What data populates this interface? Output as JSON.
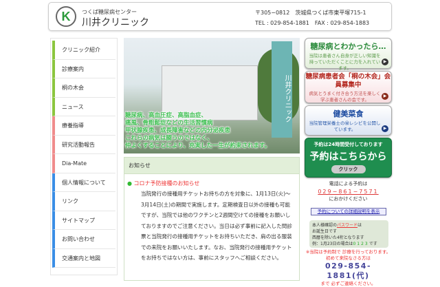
{
  "header": {
    "subtitle": "つくば糖尿病センター",
    "clinic_name": "川井クリニック",
    "logo_letter": "K",
    "address": "〒305−0812　茨城県つくば市東平塚715-1",
    "contact": "TEL : 029-854-1881　FAX : 029-854-1883"
  },
  "sidebar": {
    "items": [
      {
        "label": "クリニック紹介",
        "color": "#8cc63f"
      },
      {
        "label": "診療案内",
        "color": "#8cc63f"
      },
      {
        "label": "桐の木会",
        "color": "#8cc63f"
      },
      {
        "label": "ニュース",
        "color": "#8cc63f"
      },
      {
        "label": "療養指導",
        "color": "#f08c8c"
      },
      {
        "label": "研究活動報告",
        "color": "#f08c8c"
      },
      {
        "label": "Dia-Mate",
        "color": "#f08c8c"
      },
      {
        "label": "個人情報について",
        "color": "#3a8ee6"
      },
      {
        "label": "リンク",
        "color": "#3a8ee6"
      },
      {
        "label": "サイトマップ",
        "color": "#3a8ee6"
      },
      {
        "label": "お問い合わせ",
        "color": "#3a8ee6"
      },
      {
        "label": "交通案内と地図",
        "color": "#3a8ee6"
      }
    ]
  },
  "hero": {
    "sign": "川井クリニック",
    "lines": [
      "糖尿病、高血圧症、高脂血症、",
      "痛風、骨粗鬆症などの生活習慣病",
      "甲状腺疾患、成長障害などの内分泌疾患",
      "これらの病気は闘うのではなく、",
      "仲よくすることにより、充実した一生が約束されます。"
    ]
  },
  "notice": {
    "heading": "お知らせ",
    "title": "コロナ予防接種のお知らせ",
    "body": "当院発行の接種用チケットお持ちの方を対象に、1月13日(火)〜3月14日(土)の期間で実施します。定期検査日以外の接種も可能ですが、当院では他のワクチンと2週間空けての接種をお願いしておりますのでご注意ください。当日は必ず事前に記入した問診票と当院発行の接種用チケットをお持ちいただき、肩の出る服装での来院をお願いいたします。なお、当院発行の接種用チケットをお持ちではない方は、事前にスタッフへご相談ください。"
  },
  "banners": [
    {
      "title": "糖尿病とわかったら…",
      "desc": "当院は患者さん自身が正しい知識を持っていただくことに力を入れています。"
    },
    {
      "title": "糖尿病患者会「桐の木会」会員募集中",
      "desc": "病気とうまく付き合う方法を楽しく学ぶ患者さんの会です。"
    },
    {
      "title": "健美菜食",
      "desc": "当院管理栄養士の㊙レシピを公開しています。"
    }
  ],
  "reserve": {
    "note": "予約は24時間受付しております",
    "main": "予約はこちらから",
    "button": "クリック",
    "phone_intro": "電話による予約は",
    "phone": "029−861−7571",
    "phone_outro": "におかけください",
    "detail_link": "予約についての詳細説明を表示"
  },
  "password": {
    "l1a": "本人様確認の",
    "l1b": "パスワード",
    "l1c": "は",
    "l2": "お誕生日です",
    "l3": "西暦を除いた4桁となります",
    "l4a": "例：1月23日の場合は",
    "l4b": "0123",
    "l4c": "です"
  },
  "first_visit": {
    "text": "※当院は予約制で 診療を行っております。初めて来院なさる方は",
    "phone": "029-854-1881(代)",
    "tail": "まで 必ずご連絡ください。"
  }
}
